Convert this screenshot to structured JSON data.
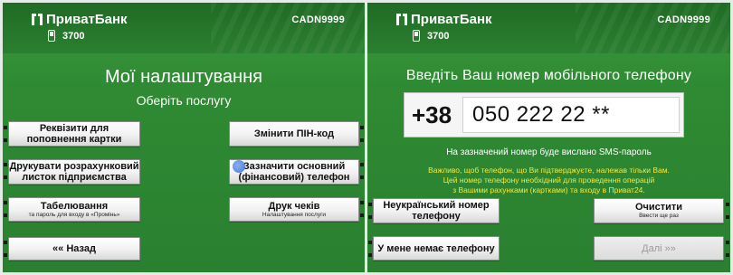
{
  "colors": {
    "screen_green": "#2f8b33",
    "header_green": "#1f6b25",
    "warning_yellow": "#f2ea3c",
    "touch_dot_blue": "#3b6fd6"
  },
  "left_screen": {
    "header": {
      "logo_text": "ПриватБанк",
      "logo_icon": "privatbank-logo-icon",
      "phone_icon": "mobile-phone-icon",
      "phone_number": "3700",
      "atm_id": "CADN9999"
    },
    "title": "Мої налаштування",
    "subtitle": "Оберіть послугу",
    "buttons": {
      "requisites": {
        "main": "Реквізити для поповнення картки",
        "sub": ""
      },
      "change_pin": {
        "main": "Змінити ПІН-код",
        "sub": ""
      },
      "print_sheet": {
        "main": "Друкувати розрахунковий листок підприємства",
        "sub": ""
      },
      "set_phone": {
        "main": "Зазначити основний (фінансовий) телефон",
        "sub": ""
      },
      "tabulation": {
        "main": "Табелювання",
        "sub": "та пароль для входу в «Промінь»"
      },
      "print_checks": {
        "main": "Друк чеків",
        "sub": "Налаштування послуги"
      },
      "back": {
        "main": "«« Назад",
        "sub": ""
      }
    }
  },
  "right_screen": {
    "header": {
      "logo_text": "ПриватБанк",
      "logo_icon": "privatbank-logo-icon",
      "phone_icon": "mobile-phone-icon",
      "phone_number": "3700",
      "atm_id": "CADN9999"
    },
    "prompt": "Введіть Ваш номер мобільного телефону",
    "country_code": "+38",
    "phone_input_value": "050 222 22 **",
    "sms_note": "На зазначений номер буде вислано SMS-пароль",
    "warning_lines": [
      "Важливо, щоб телефон, що Ви підтверджуєте, належав тільки Вам.",
      "Цей номер телефону необхідний для проведення операцій",
      "з Вашими рахунками (картками) та входу в Приват24."
    ],
    "buttons": {
      "non_ukrainian": {
        "main": "Неукраїнський номер телефону",
        "sub": ""
      },
      "clear": {
        "main": "Очистити",
        "sub": "Ввести ще раз"
      },
      "no_phone": {
        "main": "У мене немає телефону",
        "sub": ""
      },
      "next": {
        "main": "Далі »»",
        "sub": ""
      }
    }
  }
}
